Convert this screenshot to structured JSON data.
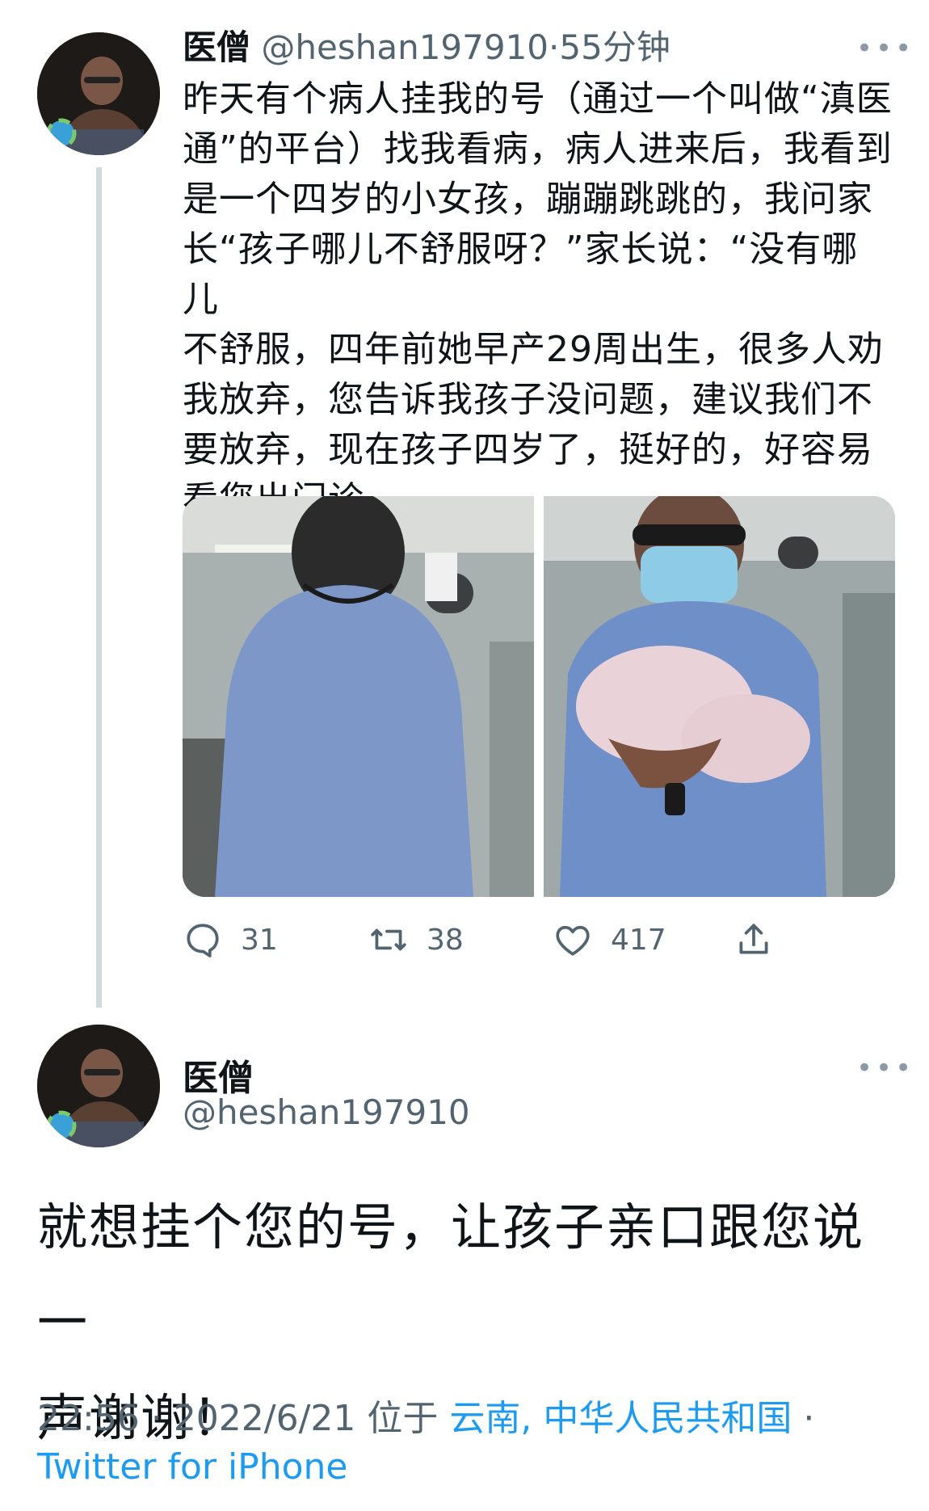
{
  "tweet1": {
    "display_name": "医僧",
    "handle": "@heshan197910",
    "separator": "·",
    "time_ago": "55分钟",
    "more": "•••",
    "text": "昨天有个病人挂我的号（通过一个叫做“滇医通”的平台）找我看病，病人进来后，我看到是一个四岁的小女孩，蹦蹦跳跳的，我问家长“孩子哪儿不舒服呀？”家长说：“没有哪儿不舒服，四年前她早产29周出生，很多人劝我放弃，您告诉我孩子没问题，建议我们不要放弃，现在孩子四岁了，挺好的，好容易看您出门诊",
    "lines": [
      "昨天有个病人挂我的号（通过一个叫做“滇医",
      "通”的平台）找我看病，病人进来后，我看到",
      "是一个四岁的小女孩，蹦蹦跳跳的，我问家",
      "长“孩子哪儿不舒服呀？”家长说：“没有哪儿",
      "不舒服，四年前她早产29周出生，很多人劝",
      "我放弃，您告诉我孩子没问题，建议我们不",
      "要放弃，现在孩子四岁了，挺好的，好容易",
      "看您出门诊"
    ],
    "actions": {
      "reply_count": "31",
      "retweet_count": "38",
      "like_count": "417"
    }
  },
  "tweet2": {
    "display_name": "医僧",
    "handle": "@heshan197910",
    "more": "•••",
    "lines": [
      "就想挂个您的号，让孩子亲口跟您说一",
      "声谢谢！"
    ],
    "footer": {
      "time": "22:56",
      "sep1": "·",
      "date": "2022/6/21",
      "location_prefix": "位于",
      "location": "云南, 中华人民共和国",
      "sep2": "·",
      "source": "Twitter for iPhone"
    }
  },
  "colors": {
    "text": "#0f1419",
    "secondary": "#536471",
    "link": "#1d9bf0",
    "thread_line": "#cfd9de"
  },
  "icons": [
    "reply-icon",
    "retweet-icon",
    "like-icon",
    "share-icon",
    "more-icon"
  ]
}
